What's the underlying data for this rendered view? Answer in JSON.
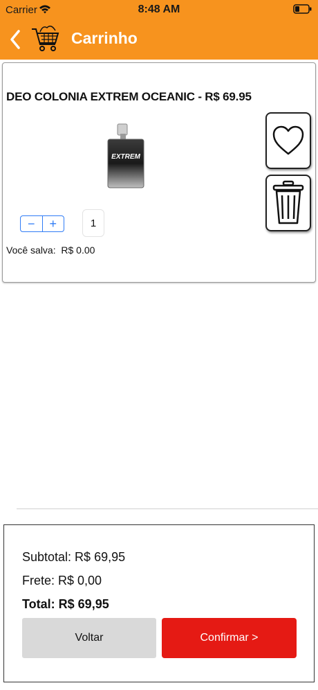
{
  "status_bar": {
    "carrier": "Carrier",
    "time": "8:48 AM"
  },
  "header": {
    "title": "Carrinho",
    "back_icon": "chevron-left-icon",
    "cart_icon": "shopping-cart-icon"
  },
  "product": {
    "title": "DEO COLONIA EXTREM OCEANIC - R$ 69.95",
    "image_label": "EXTREM",
    "quantity": "1",
    "savings_label": "Você salva:",
    "savings_value": "R$ 0.00",
    "stepper_minus": "−",
    "stepper_plus": "+"
  },
  "summary": {
    "subtotal": "Subtotal: R$ 69,95",
    "frete": "Frete: R$ 0,00",
    "total": "Total: R$ 69,95"
  },
  "actions": {
    "voltar": "Voltar",
    "confirmar": "Confirmar >"
  },
  "colors": {
    "header": "#f7931e",
    "confirm": "#e51a14",
    "stepper": "#2f7cf6",
    "voltar": "#d9d9d9"
  }
}
